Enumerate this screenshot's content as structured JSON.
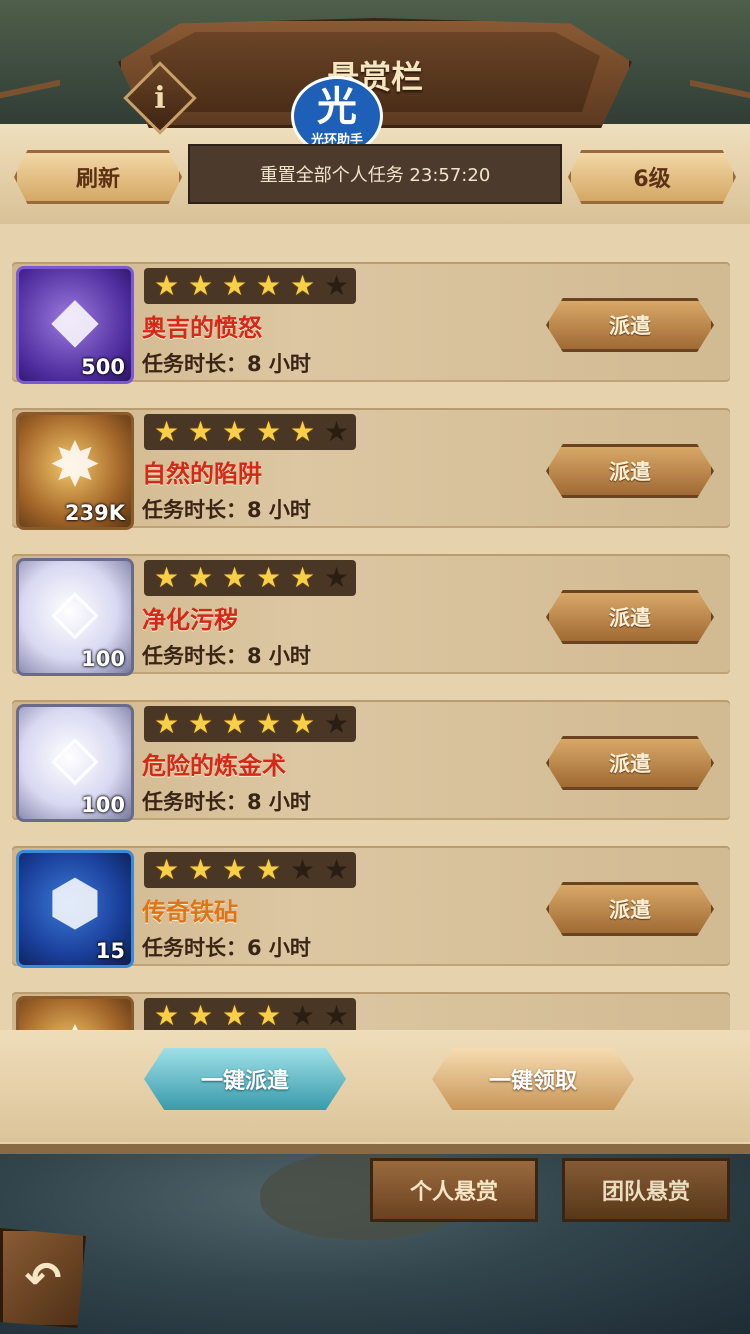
{
  "header": {
    "title": "悬赏栏",
    "info_glyph": "i"
  },
  "watermark": {
    "glyph": "光",
    "text": "光环助手"
  },
  "toolbar": {
    "refresh_label": "刷新",
    "reset_text": "重置全部个人任务 23:57:20",
    "level_label": "6级"
  },
  "tasks": [
    {
      "icon": "crystal-ore-icon",
      "icon_glyph": "◆",
      "quantity": "500",
      "stars": 5,
      "name": "奥吉的愤怒",
      "name_color": "red",
      "duration": "任务时长：8 小时",
      "button": "派遣"
    },
    {
      "icon": "gold-coin-icon",
      "icon_glyph": "✸",
      "quantity": "239K",
      "stars": 5,
      "name": "自然的陷阱",
      "name_color": "red",
      "duration": "任务时长：8 小时",
      "button": "派遣"
    },
    {
      "icon": "diamond-icon",
      "icon_glyph": "◇",
      "quantity": "100",
      "stars": 5,
      "name": "净化污秽",
      "name_color": "red",
      "duration": "任务时长：8 小时",
      "button": "派遣"
    },
    {
      "icon": "diamond-icon",
      "icon_glyph": "◇",
      "quantity": "100",
      "stars": 5,
      "name": "危险的炼金术",
      "name_color": "red",
      "duration": "任务时长：8 小时",
      "button": "派遣"
    },
    {
      "icon": "hero-shard-icon",
      "icon_glyph": "⬢",
      "quantity": "15",
      "stars": 4,
      "name": "传奇铁砧",
      "name_color": "orange",
      "duration": "任务时长：6 小时",
      "button": "派遣"
    },
    {
      "icon": "gold-coin-icon",
      "icon_glyph": "✸",
      "quantity": "",
      "stars": 4,
      "name": "",
      "name_color": "red",
      "duration": "",
      "button": ""
    }
  ],
  "actions": {
    "dispatch_all": "一键派遣",
    "claim_all": "一键领取"
  },
  "tabs": {
    "personal": "个人悬赏",
    "team": "团队悬赏"
  },
  "colors": {
    "name_red": "#d42818",
    "name_orange": "#e07418",
    "star_on": "#f7d047"
  }
}
